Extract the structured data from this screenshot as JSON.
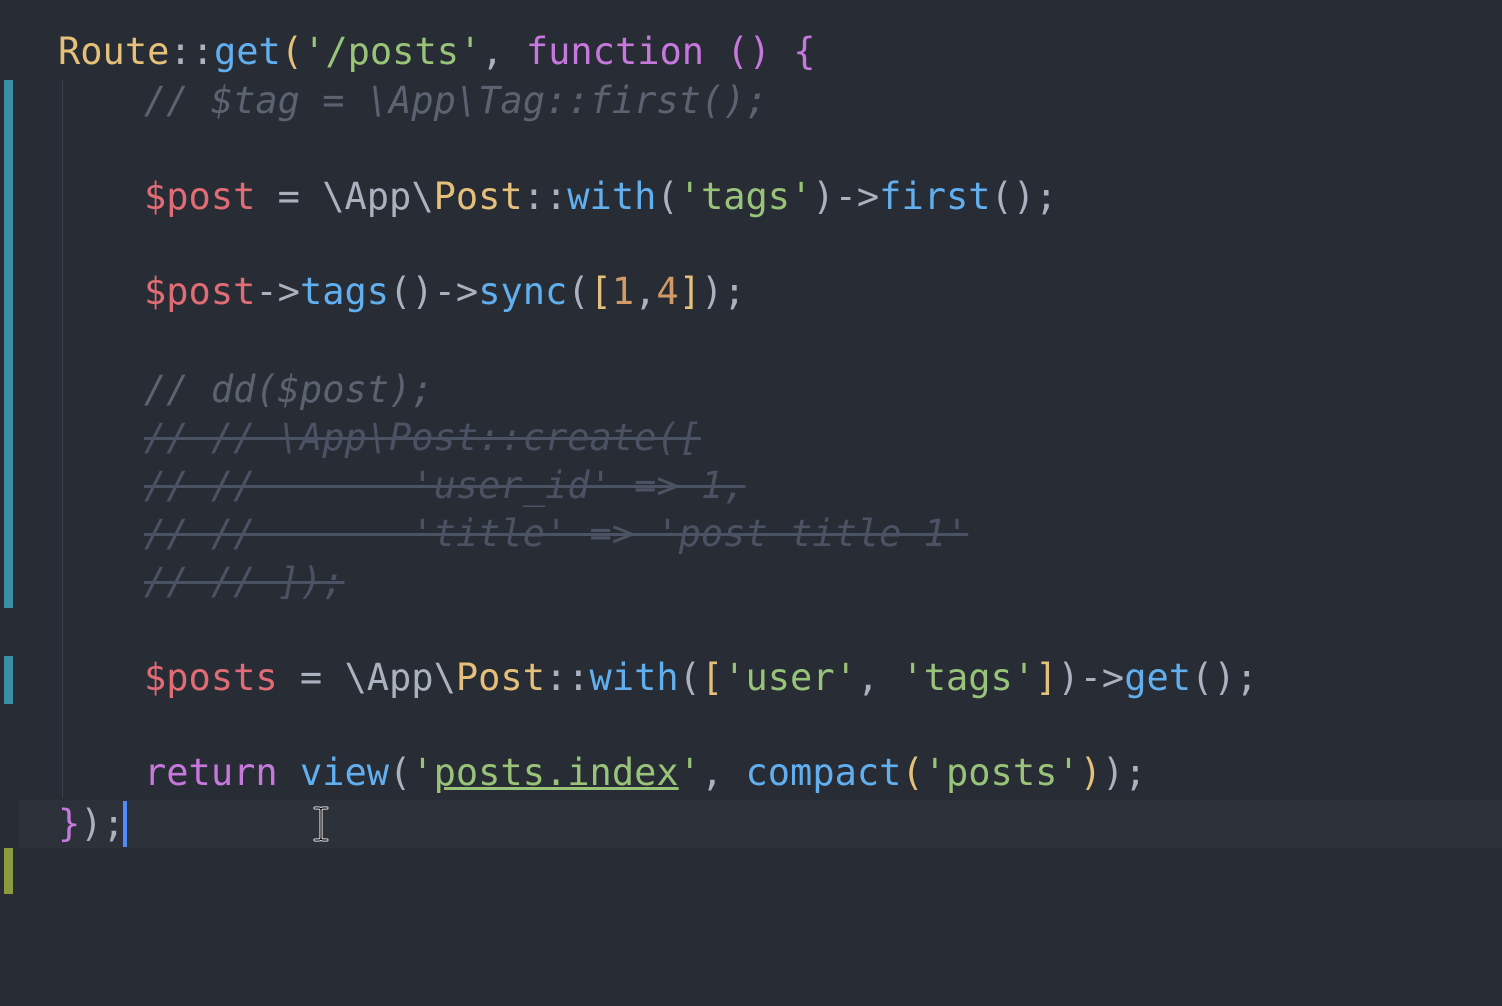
{
  "editor": {
    "lines": {
      "l1": {
        "route": "Route",
        "sep": "::",
        "get": "get",
        "open": "(",
        "path": "'/posts'",
        "comma": ", ",
        "function": "function",
        "sp": " ",
        "parens": "()",
        "brace": "{"
      },
      "l2": "// $tag = \\App\\Tag::first();",
      "l3": {
        "var": "$post",
        "eq": " = \\App\\",
        "cls": "Post",
        "sep": "::",
        "with": "with",
        "open": "(",
        "arg": "'tags'",
        "close": ")",
        "arrow": "->",
        "first": "first",
        "end": "();"
      },
      "l4": {
        "var": "$post",
        "arrow1": "->",
        "tags": "tags",
        "call": "()",
        "arrow2": "->",
        "sync": "sync",
        "open": "(",
        "lb": "[",
        "n1": "1",
        "comma": ",",
        "n2": "4",
        "rb": "]",
        "end": ");"
      },
      "l5": "// dd($post);",
      "l6": "// // \\App\\Post::create([",
      "l7": "// //       'user_id' => 1,",
      "l8": "// //       'title' => 'post title 1'",
      "l9": "// // ]);",
      "l10": {
        "var": "$posts",
        "eq": " = \\App\\",
        "cls": "Post",
        "sep": "::",
        "with": "with",
        "open": "(",
        "lb": "[",
        "a1": "'user'",
        "comma": ", ",
        "a2": "'tags'",
        "rb": "]",
        "close": ")",
        "arrow": "->",
        "get": "get",
        "end": "();"
      },
      "l11": {
        "return": "return",
        "sp": " ",
        "view": "view",
        "open": "(",
        "q1": "'",
        "tpl": "posts.index",
        "q2": "'",
        "comma": ", ",
        "compact": "compact",
        "open2": "(",
        "arg": "'posts'",
        "close2": ")",
        "end": ");"
      },
      "l12": {
        "brace": "}",
        "end": ");"
      }
    }
  }
}
